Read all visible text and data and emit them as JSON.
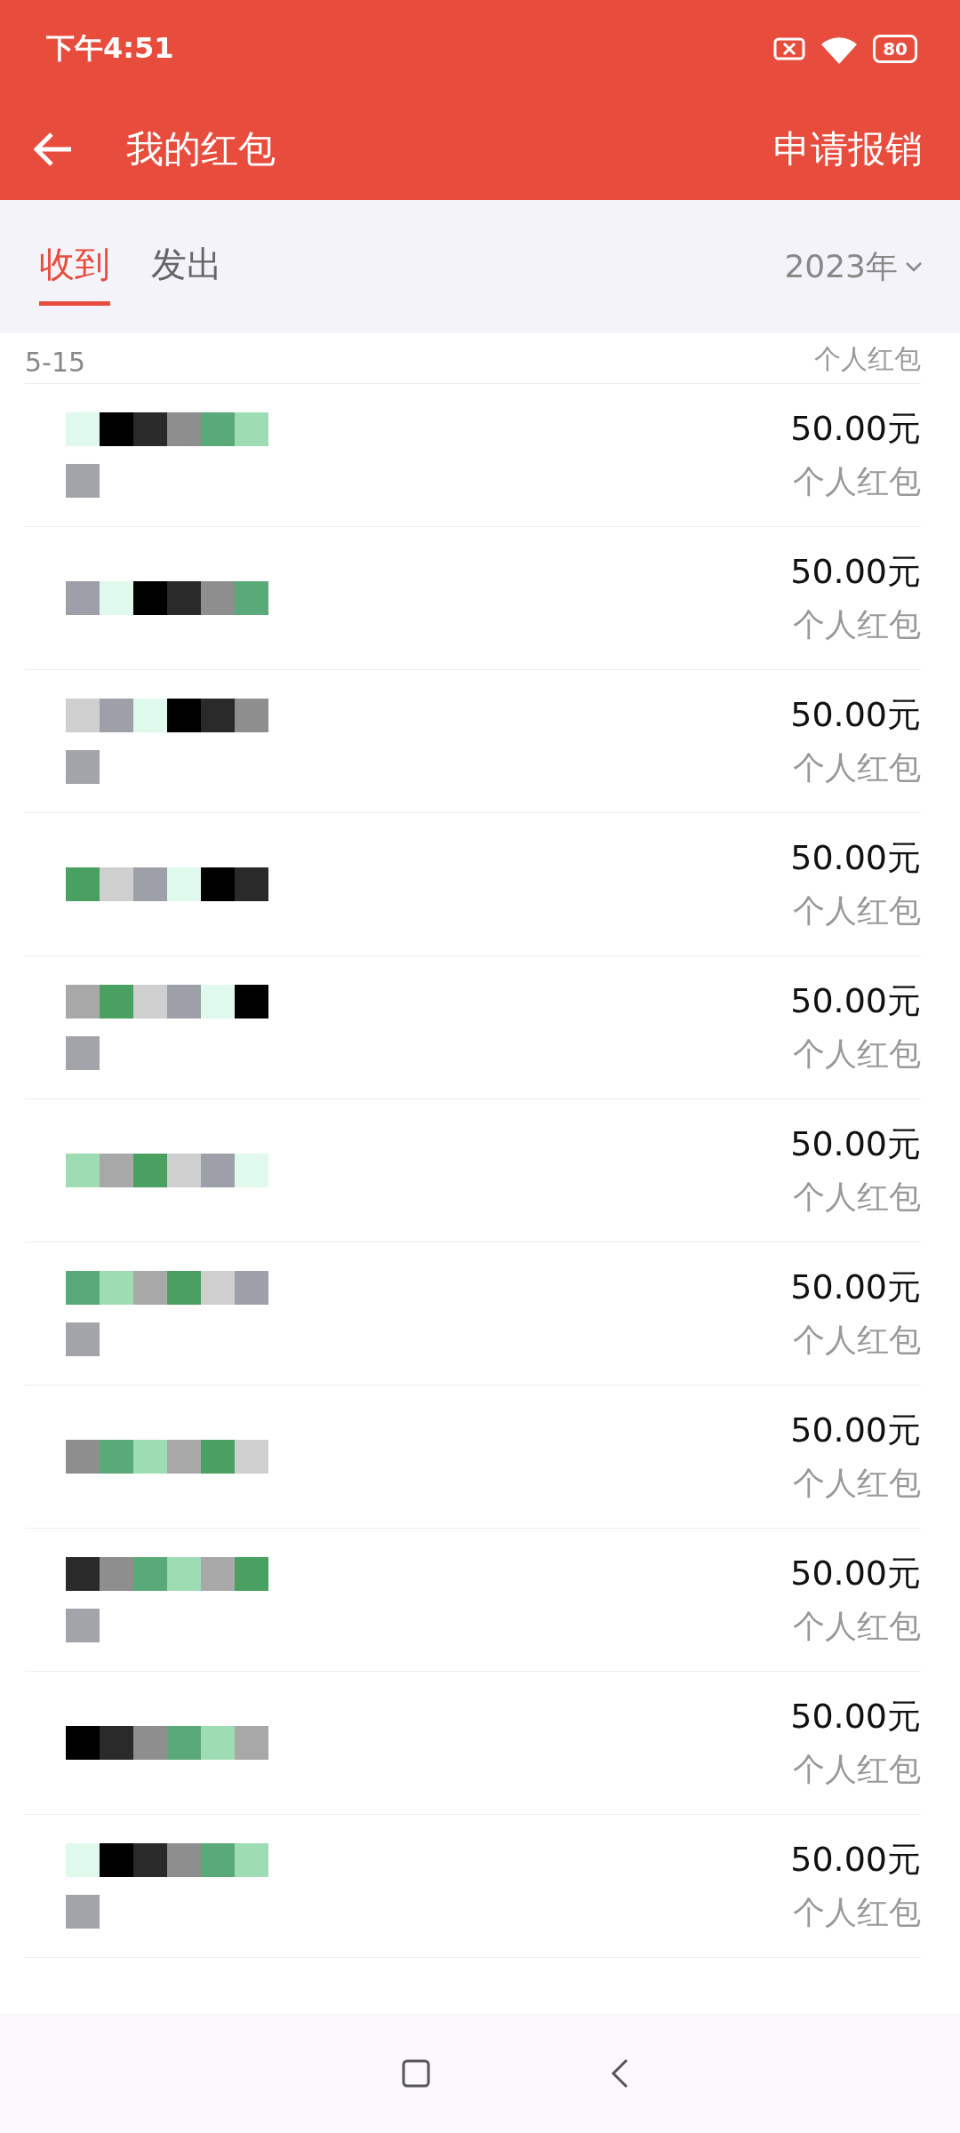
{
  "status_bar": {
    "time": "下午4:51",
    "battery": "80"
  },
  "header": {
    "title": "我的红包",
    "action": "申请报销"
  },
  "tabs": [
    {
      "label": "收到",
      "selected": true
    },
    {
      "label": "发出",
      "selected": false
    }
  ],
  "year_filter": "2023年",
  "rows": [
    {
      "date": "5-15",
      "amount": "",
      "type": "个人红包"
    },
    {
      "amount": "50.00元",
      "type": "个人红包"
    },
    {
      "amount": "50.00元",
      "type": "个人红包"
    },
    {
      "amount": "50.00元",
      "type": "个人红包"
    },
    {
      "amount": "50.00元",
      "type": "个人红包"
    },
    {
      "amount": "50.00元",
      "type": "个人红包"
    },
    {
      "amount": "50.00元",
      "type": "个人红包"
    },
    {
      "amount": "50.00元",
      "type": "个人红包"
    },
    {
      "amount": "50.00元",
      "type": "个人红包"
    },
    {
      "amount": "50.00元",
      "type": "个人红包"
    },
    {
      "amount": "50.00元",
      "type": "个人红包"
    },
    {
      "amount": "50.00元",
      "type": "个人红包"
    }
  ]
}
